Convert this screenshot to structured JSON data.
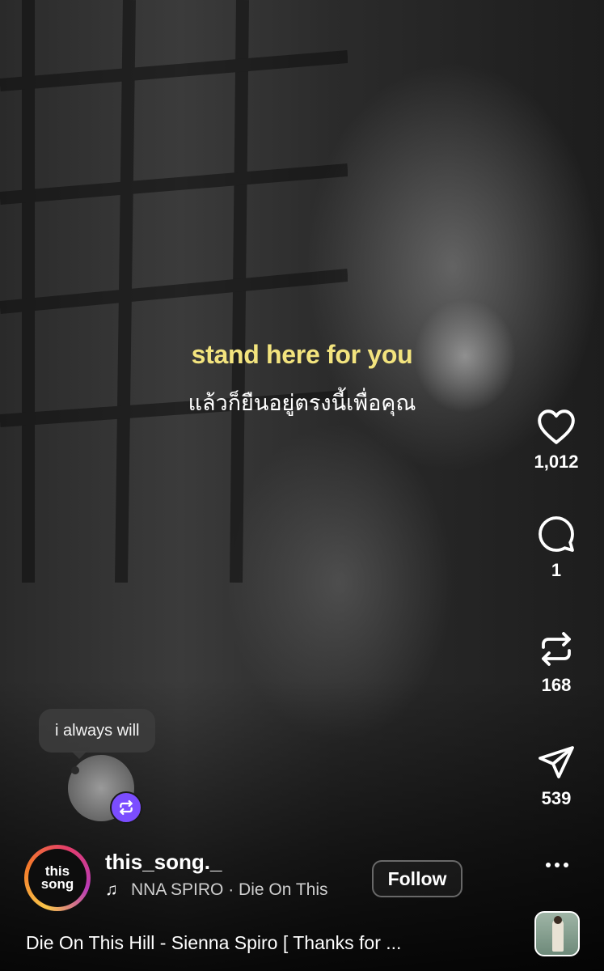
{
  "video": {
    "lyric_english": "stand here for you",
    "lyric_thai": "แล้วก็ยืนอยู่ตรงนี้เพื่อคุณ"
  },
  "actions": {
    "like": {
      "icon": "heart-icon",
      "count": "1,012"
    },
    "comment": {
      "icon": "comment-icon",
      "count": "1"
    },
    "repost": {
      "icon": "repost-icon",
      "count": "168"
    },
    "share": {
      "icon": "send-icon",
      "count": "539"
    },
    "more": {
      "icon": "more-icon"
    }
  },
  "remix": {
    "bubble_text": "i always will",
    "badge_icon": "repost-icon",
    "badge_color": "#7b4dff"
  },
  "profile": {
    "avatar_text": "this song",
    "username": "this_song._",
    "audio_icon": "music-note-icon",
    "audio_text": "NNA SPIRO · Die On This",
    "follow_label": "Follow"
  },
  "caption": "Die On This Hill - Sienna Spiro [ Thanks for ...",
  "colors": {
    "lyric_highlight": "#f3e47e",
    "story_ring": [
      "#f8c64a",
      "#f57b2a",
      "#e33d6b",
      "#b93bb8"
    ]
  }
}
